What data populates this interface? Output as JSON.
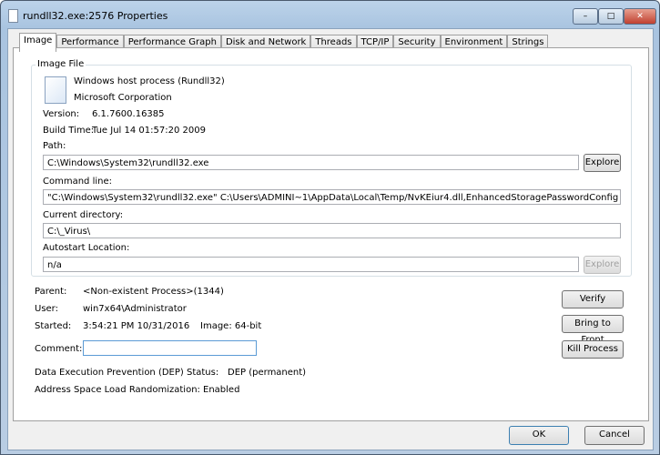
{
  "window": {
    "title": "rundll32.exe:2576 Properties"
  },
  "tabs": [
    "Image",
    "Performance",
    "Performance Graph",
    "Disk and Network",
    "Threads",
    "TCP/IP",
    "Security",
    "Environment",
    "Strings"
  ],
  "image_file": {
    "group_label": "Image File",
    "description": "Windows host process (Rundll32)",
    "company": "Microsoft Corporation",
    "version_label": "Version:",
    "version": "6.1.7600.16385",
    "build_label": "Build Time:",
    "build": "Tue Jul 14 01:57:20 2009",
    "path_label": "Path:",
    "path": "C:\\Windows\\System32\\rundll32.exe",
    "explore_label": "Explore",
    "cmd_label": "Command line:",
    "cmd": "\"C:\\Windows\\System32\\rundll32.exe\"  C:\\Users\\ADMINI~1\\AppData\\Local\\Temp/NvKEiur4.dll,EnhancedStoragePasswordConfig",
    "cwd_label": "Current directory:",
    "cwd": "C:\\_Virus\\",
    "autostart_label": "Autostart Location:",
    "autostart": "n/a"
  },
  "process": {
    "parent_label": "Parent:",
    "parent": "<Non-existent Process>(1344)",
    "user_label": "User:",
    "user": "win7x64\\Administrator",
    "started_label": "Started:",
    "started": "3:54:21 PM   10/31/2016",
    "image": "Image: 64-bit",
    "comment_label": "Comment:",
    "comment": "",
    "dep_label": "Data Execution Prevention (DEP) Status:",
    "dep": "DEP (permanent)",
    "aslr_label": "Address Space Load Randomization:",
    "aslr": "Enabled"
  },
  "buttons": {
    "verify": "Verify",
    "bring_to_front": "Bring to Front",
    "kill": "Kill Process",
    "ok": "OK",
    "cancel": "Cancel"
  }
}
